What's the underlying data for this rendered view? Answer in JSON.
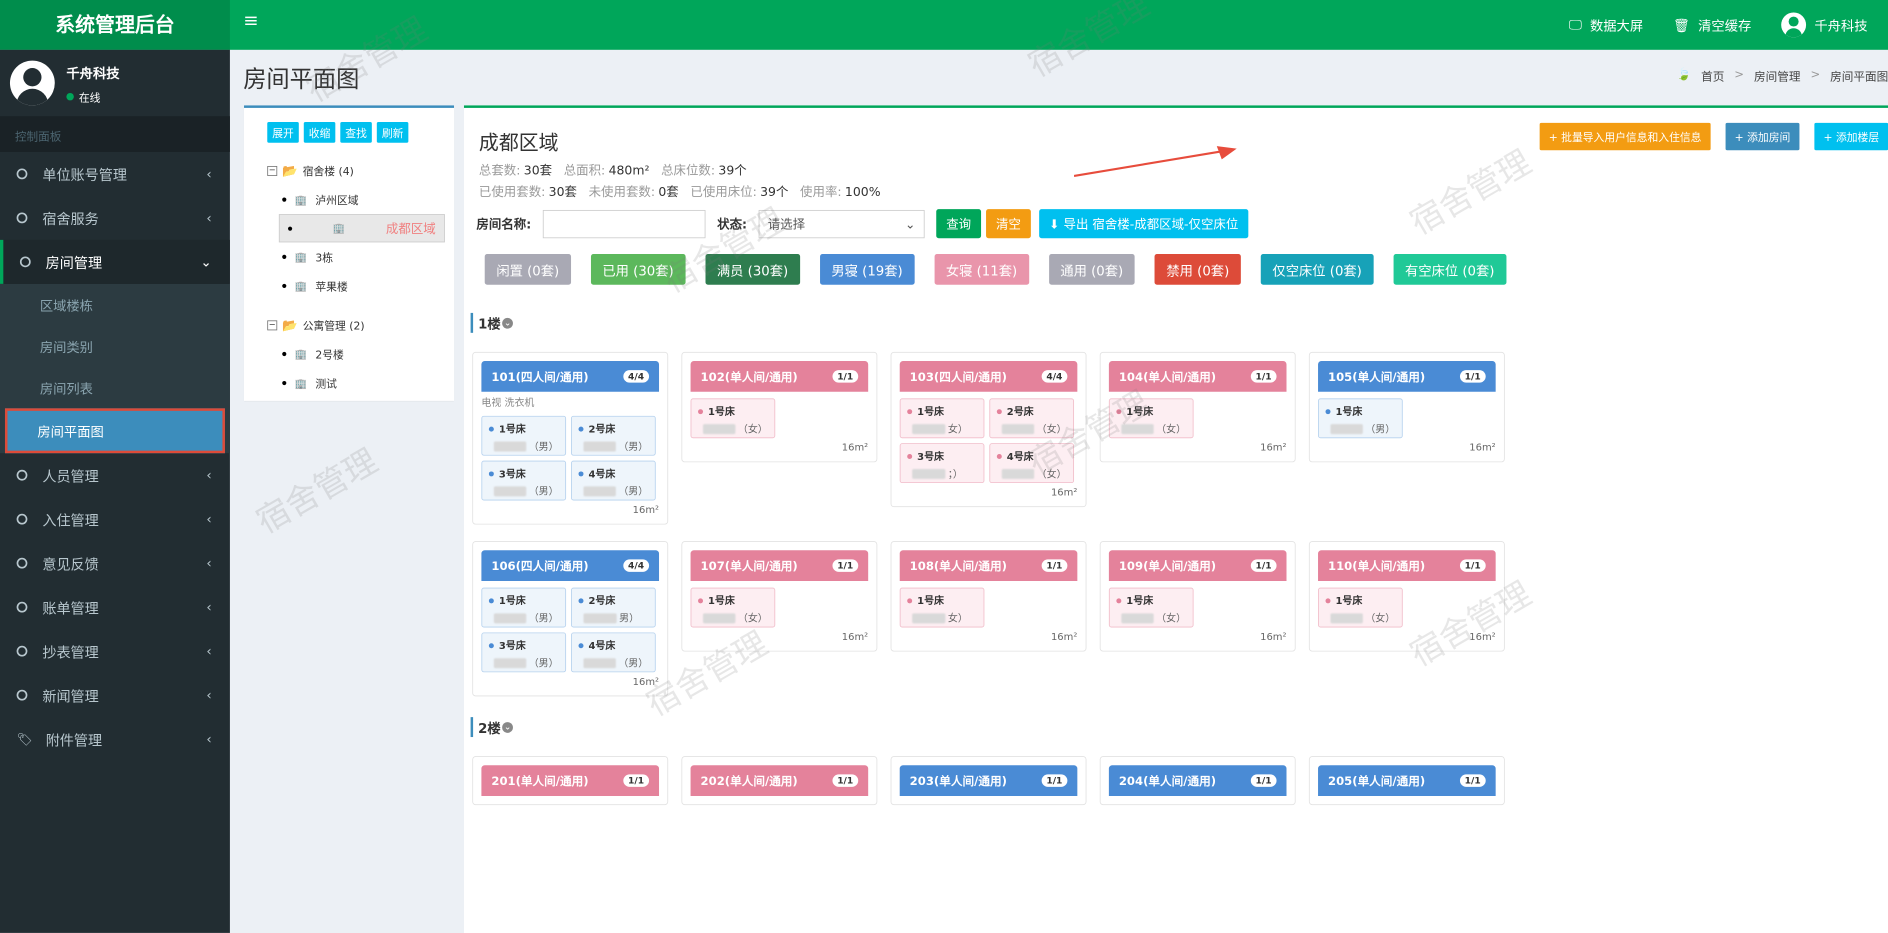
{
  "app": {
    "title": "系统管理后台"
  },
  "header": {
    "menu_icon": "hamburger-icon",
    "screen": "数据大屏",
    "cache": "清空缓存",
    "user": "千舟科技"
  },
  "sidebar": {
    "user_name": "千舟科技",
    "status": "在线",
    "section": "控制面板",
    "items": [
      {
        "label": "单位账号管理",
        "icon": "circle-icon"
      },
      {
        "label": "宿舍服务",
        "icon": "circle-icon"
      },
      {
        "label": "房间管理",
        "icon": "circle-icon"
      }
    ],
    "submenu": [
      "区域楼栋",
      "房间类别",
      "房间列表",
      "房间平面图"
    ],
    "items2": [
      {
        "label": "人员管理",
        "icon": "circle-icon"
      },
      {
        "label": "入住管理",
        "icon": "circle-icon"
      },
      {
        "label": "意见反馈",
        "icon": "circle-icon"
      },
      {
        "label": "账单管理",
        "icon": "circle-icon"
      },
      {
        "label": "抄表管理",
        "icon": "circle-icon"
      },
      {
        "label": "新闻管理",
        "icon": "circle-icon"
      },
      {
        "label": "附件管理",
        "icon": "tags-icon"
      }
    ]
  },
  "page": {
    "title": "房间平面图",
    "crumbs": [
      "首页",
      "房间管理",
      "房间平面图"
    ]
  },
  "tree": {
    "buttons": [
      "展开",
      "收缩",
      "查找",
      "刷新"
    ],
    "groups": [
      {
        "label": "宿舍楼 (4)",
        "leaves": [
          "泸州区域",
          "成都区域",
          "3栋",
          "苹果楼"
        ]
      },
      {
        "label": "公寓管理 (2)",
        "leaves": [
          "2号楼",
          "测试"
        ]
      }
    ]
  },
  "area": {
    "title": "成都区域",
    "stats1": [
      {
        "k": "总套数:",
        "v": "30套"
      },
      {
        "k": "总面积:",
        "v": "480m²"
      },
      {
        "k": "总床位数:",
        "v": "39个"
      }
    ],
    "stats2": [
      {
        "k": "已使用套数:",
        "v": "30套"
      },
      {
        "k": "未使用套数:",
        "v": "0套"
      },
      {
        "k": "已使用床位:",
        "v": "39个"
      },
      {
        "k": "使用率:",
        "v": "100%"
      }
    ],
    "buttons": [
      "+ 批量导入用户信息和入住信息",
      "+ 添加房间",
      "+ 添加楼层"
    ],
    "button_colors": [
      "#f39c12",
      "#3c8dbc",
      "#00c0ef"
    ]
  },
  "search": {
    "name_label": "房间名称:",
    "name_value": "",
    "status_label": "状态:",
    "status_value": "请选择",
    "query": "查询",
    "clear": "清空",
    "export": "导出 宿舍楼-成都区域-仅空床位"
  },
  "filters": [
    {
      "label": "闲置 (0套)",
      "color": "#a9a9b4"
    },
    {
      "label": "已用 (30套)",
      "color": "#5cb85c"
    },
    {
      "label": "满员 (30套)",
      "color": "#2e7d4f"
    },
    {
      "label": "男寝 (19套)",
      "color": "#4a8bd5"
    },
    {
      "label": "女寝 (11套)",
      "color": "#e995ab"
    },
    {
      "label": "通用 (0套)",
      "color": "#a9a9b4"
    },
    {
      "label": "禁用 (0套)",
      "color": "#dd4b39"
    },
    {
      "label": "仅空床位 (0套)",
      "color": "#17a2b8"
    },
    {
      "label": "有空床位 (0套)",
      "color": "#20c997"
    }
  ],
  "floors": [
    "1楼",
    "2楼"
  ],
  "rooms": [
    {
      "name": "101(四人间/通用)",
      "cnt": "4/4",
      "c": "blue",
      "desc": "电视 洗衣机",
      "beds": [
        [
          "1号床",
          "（男）"
        ],
        [
          "2号床",
          "（男）"
        ],
        [
          "3号床",
          "（男）"
        ],
        [
          "4号床",
          "（男）"
        ]
      ],
      "area": "16m²"
    },
    {
      "name": "102(单人间/通用)",
      "cnt": "1/1",
      "c": "pink",
      "desc": "",
      "beds": [
        [
          "1号床",
          "（女）"
        ]
      ],
      "area": "16m²"
    },
    {
      "name": "103(四人间/通用)",
      "cnt": "4/4",
      "c": "pink",
      "desc": "",
      "beds": [
        [
          "1号床",
          "女）"
        ],
        [
          "2号床",
          "（女）"
        ],
        [
          "3号床",
          "；）"
        ],
        [
          "4号床",
          "（女）"
        ]
      ],
      "area": "16m²"
    },
    {
      "name": "104(单人间/通用)",
      "cnt": "1/1",
      "c": "pink",
      "desc": "",
      "beds": [
        [
          "1号床",
          "（女）"
        ]
      ],
      "area": "16m²"
    },
    {
      "name": "105(单人间/通用)",
      "cnt": "1/1",
      "c": "blue",
      "desc": "",
      "beds": [
        [
          "1号床",
          "（男）"
        ]
      ],
      "area": "16m²"
    },
    {
      "name": "106(四人间/通用)",
      "cnt": "4/4",
      "c": "blue",
      "desc": "",
      "beds": [
        [
          "1号床",
          "（男）"
        ],
        [
          "2号床",
          "男）"
        ],
        [
          "3号床",
          "（男）"
        ],
        [
          "4号床",
          "（男）"
        ]
      ],
      "area": "16m²"
    },
    {
      "name": "107(单人间/通用)",
      "cnt": "1/1",
      "c": "pink",
      "desc": "",
      "beds": [
        [
          "1号床",
          "（女）"
        ]
      ],
      "area": "16m²"
    },
    {
      "name": "108(单人间/通用)",
      "cnt": "1/1",
      "c": "pink",
      "desc": "",
      "beds": [
        [
          "1号床",
          "女）"
        ]
      ],
      "area": "16m²"
    },
    {
      "name": "109(单人间/通用)",
      "cnt": "1/1",
      "c": "pink",
      "desc": "",
      "beds": [
        [
          "1号床",
          "（女）"
        ]
      ],
      "area": "16m²"
    },
    {
      "name": "110(单人间/通用)",
      "cnt": "1/1",
      "c": "pink",
      "desc": "",
      "beds": [
        [
          "1号床",
          "（女）"
        ]
      ],
      "area": "16m²"
    },
    {
      "name": "201(单人间/通用)",
      "cnt": "1/1",
      "c": "pink",
      "desc": "",
      "beds": [],
      "area": ""
    },
    {
      "name": "202(单人间/通用)",
      "cnt": "1/1",
      "c": "pink",
      "desc": "",
      "beds": [],
      "area": ""
    },
    {
      "name": "203(单人间/通用)",
      "cnt": "1/1",
      "c": "blue",
      "desc": "",
      "beds": [],
      "area": ""
    },
    {
      "name": "204(单人间/通用)",
      "cnt": "1/1",
      "c": "blue",
      "desc": "",
      "beds": [],
      "area": ""
    },
    {
      "name": "205(单人间/通用)",
      "cnt": "1/1",
      "c": "blue",
      "desc": "",
      "beds": [],
      "area": ""
    }
  ],
  "watermark": "宿舍管理"
}
